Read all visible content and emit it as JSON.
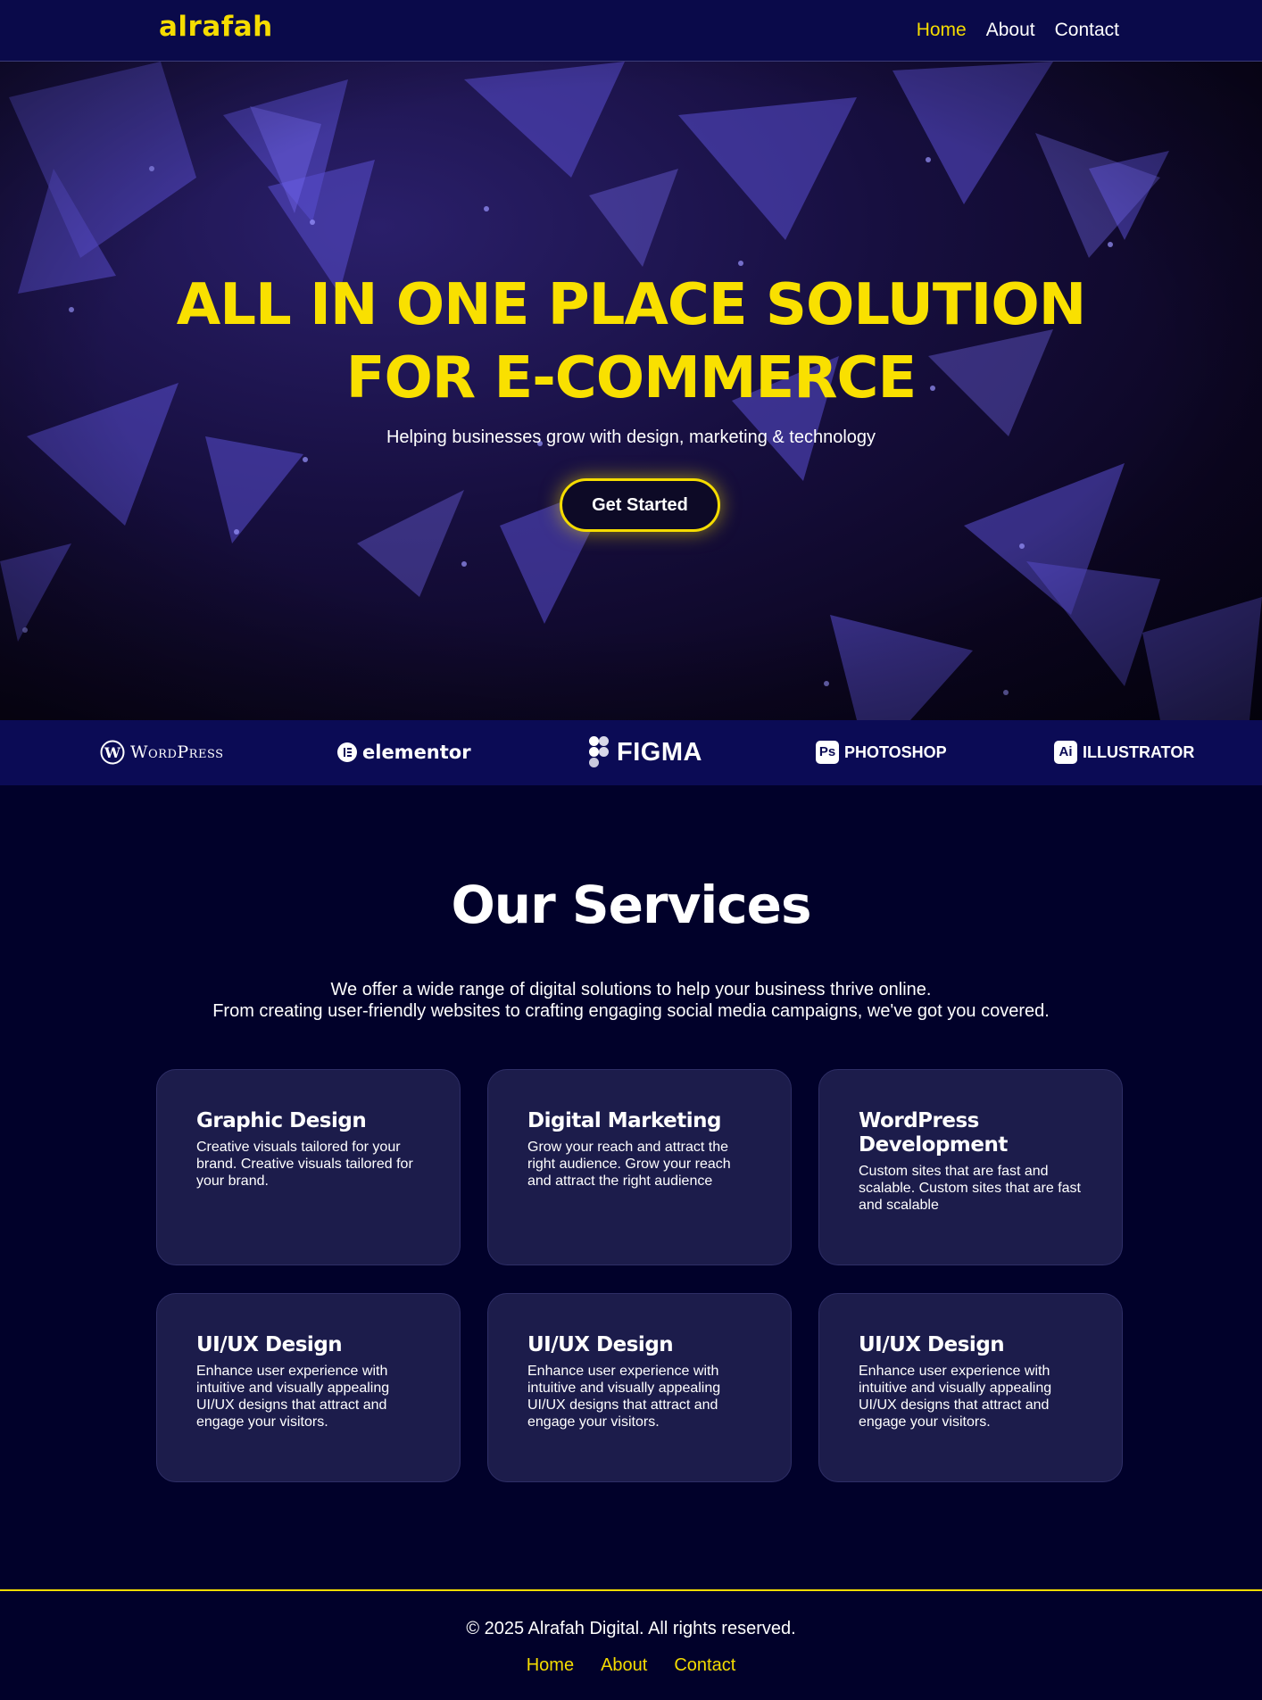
{
  "nav": {
    "logo": "alrafah",
    "links": [
      {
        "label": "Home",
        "active": true
      },
      {
        "label": "About",
        "active": false
      },
      {
        "label": "Contact",
        "active": false
      }
    ]
  },
  "hero": {
    "title": "ALL IN ONE PLACE SOLUTION FOR E-COMMERCE",
    "subtitle": "Helping businesses grow with design, marketing & technology",
    "cta_label": "Get Started"
  },
  "brands": [
    {
      "name": "WordPress",
      "text": "WordPress",
      "icon": "wordpress-logo-icon"
    },
    {
      "name": "Elementor",
      "text": "elementor",
      "icon": "elementor-logo-icon"
    },
    {
      "name": "Figma",
      "text": "FIGMA",
      "icon": "figma-logo-icon"
    },
    {
      "name": "Photoshop",
      "text": "PHOTOSHOP",
      "badge": "Ps",
      "icon": "photoshop-logo-icon"
    },
    {
      "name": "Illustrator",
      "text": "ILLUSTRATOR",
      "badge": "Ai",
      "icon": "illustrator-logo-icon"
    }
  ],
  "services": {
    "title": "Our Services",
    "intro_line1": "We offer a wide range of digital solutions to help your business thrive online.",
    "intro_line2": "From creating user-friendly websites to crafting engaging social media campaigns, we've got you covered.",
    "cards": [
      {
        "title": "Graphic Design",
        "text": "Creative visuals tailored for your brand. Creative visuals tailored for your brand."
      },
      {
        "title": "Digital Marketing",
        "text": "Grow your reach and attract the right audience. Grow your reach and attract the right audience"
      },
      {
        "title": "WordPress Development",
        "text": "Custom sites that are fast and scalable. Custom sites that are fast and scalable"
      },
      {
        "title": "UI/UX Design",
        "text": "Enhance user experience with intuitive and visually appealing UI/UX designs that attract and engage your visitors."
      },
      {
        "title": "UI/UX Design",
        "text": "Enhance user experience with intuitive and visually appealing UI/UX designs that attract and engage your visitors."
      },
      {
        "title": "UI/UX Design",
        "text": "Enhance user experience with intuitive and visually appealing UI/UX designs that attract and engage your visitors."
      }
    ]
  },
  "footer": {
    "copyright": "© 2025 Alrafah Digital. All rights reserved.",
    "links": [
      "Home",
      "About",
      "Contact"
    ]
  },
  "colors": {
    "accent": "#f5dc00",
    "nav_bg": "#0a0a4a",
    "page_bg": "#01012a",
    "card_bg": "#1c1c4b",
    "strip_bg": "#0b0b55"
  }
}
